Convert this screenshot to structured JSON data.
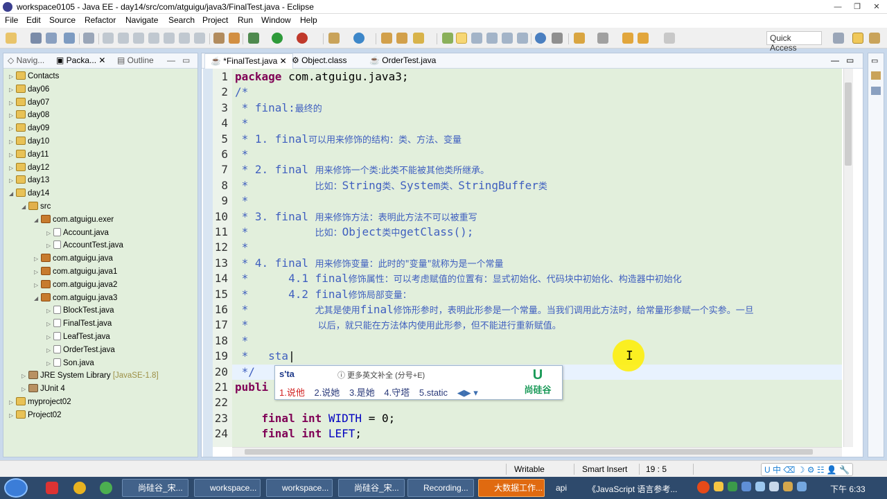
{
  "window": {
    "title": "workspace0105 - Java EE - day14/src/com/atguigu/java3/FinalTest.java - Eclipse",
    "controls": [
      "—",
      "❐",
      "✕"
    ]
  },
  "menu": [
    "File",
    "Edit",
    "Source",
    "Refactor",
    "Navigate",
    "Search",
    "Project",
    "Run",
    "Window",
    "Help"
  ],
  "toolbar": {
    "quick_access": "Quick Access"
  },
  "left_panel": {
    "tabs": [
      "Navig...",
      "Packa...",
      "Outline"
    ],
    "tree": [
      {
        "label": "Contacts",
        "depth": 0,
        "toggle": "▷",
        "type": "proj"
      },
      {
        "label": "day06",
        "depth": 0,
        "toggle": "▷",
        "type": "proj"
      },
      {
        "label": "day07",
        "depth": 0,
        "toggle": "▷",
        "type": "proj"
      },
      {
        "label": "day08",
        "depth": 0,
        "toggle": "▷",
        "type": "proj"
      },
      {
        "label": "day09",
        "depth": 0,
        "toggle": "▷",
        "type": "proj"
      },
      {
        "label": "day10",
        "depth": 0,
        "toggle": "▷",
        "type": "proj"
      },
      {
        "label": "day11",
        "depth": 0,
        "toggle": "▷",
        "type": "proj"
      },
      {
        "label": "day12",
        "depth": 0,
        "toggle": "▷",
        "type": "proj"
      },
      {
        "label": "day13",
        "depth": 0,
        "toggle": "▷",
        "type": "proj"
      },
      {
        "label": "day14",
        "depth": 0,
        "toggle": "◢",
        "type": "proj"
      },
      {
        "label": "src",
        "depth": 1,
        "toggle": "◢",
        "type": "src"
      },
      {
        "label": "com.atguigu.exer",
        "depth": 2,
        "toggle": "◢",
        "type": "pkg"
      },
      {
        "label": "Account.java",
        "depth": 3,
        "toggle": "▷",
        "type": "java"
      },
      {
        "label": "AccountTest.java",
        "depth": 3,
        "toggle": "▷",
        "type": "java"
      },
      {
        "label": "com.atguigu.java",
        "depth": 2,
        "toggle": "▷",
        "type": "pkg"
      },
      {
        "label": "com.atguigu.java1",
        "depth": 2,
        "toggle": "▷",
        "type": "pkg"
      },
      {
        "label": "com.atguigu.java2",
        "depth": 2,
        "toggle": "▷",
        "type": "pkg"
      },
      {
        "label": "com.atguigu.java3",
        "depth": 2,
        "toggle": "◢",
        "type": "pkg"
      },
      {
        "label": "BlockTest.java",
        "depth": 3,
        "toggle": "▷",
        "type": "java"
      },
      {
        "label": "FinalTest.java",
        "depth": 3,
        "toggle": "▷",
        "type": "java"
      },
      {
        "label": "LeafTest.java",
        "depth": 3,
        "toggle": "▷",
        "type": "java"
      },
      {
        "label": "OrderTest.java",
        "depth": 3,
        "toggle": "▷",
        "type": "java"
      },
      {
        "label": "Son.java",
        "depth": 3,
        "toggle": "▷",
        "type": "java"
      },
      {
        "label": "JRE System Library",
        "suffix": "[JavaSE-1.8]",
        "depth": 1,
        "toggle": "▷",
        "type": "lib"
      },
      {
        "label": "JUnit 4",
        "depth": 1,
        "toggle": "▷",
        "type": "lib"
      },
      {
        "label": "myproject02",
        "depth": 0,
        "toggle": "▷",
        "type": "proj"
      },
      {
        "label": "Project02",
        "depth": 0,
        "toggle": "▷",
        "type": "proj"
      }
    ]
  },
  "editor": {
    "tabs": [
      "*FinalTest.java",
      "Object.class",
      "OrderTest.java"
    ],
    "lines": [
      {
        "n": "1",
        "html": "<span class=\"kw\">package</span><span class=\"plain\"> com.atguigu.java3;</span>"
      },
      {
        "n": "2",
        "html": "<span class=\"cm\">/*</span>"
      },
      {
        "n": "3",
        "html": "<span class=\"cm\"> * final:</span><span class=\"cmcn\">最终的</span>"
      },
      {
        "n": "4",
        "html": "<span class=\"cm\"> *</span>"
      },
      {
        "n": "5",
        "html": "<span class=\"cm\"> * 1. final</span><span class=\"cmcn\">可以用来修饰的结构：类、方法、变量</span>"
      },
      {
        "n": "6",
        "html": "<span class=\"cm\"> *</span>"
      },
      {
        "n": "7",
        "html": "<span class=\"cm\"> * 2. final </span><span class=\"cmcn\">用来修饰一个类:此类不能被其他类所继承。</span>"
      },
      {
        "n": "8",
        "html": "<span class=\"cm\"> *          </span><span class=\"cmcn\">比如：</span><span class=\"cm\">String</span><span class=\"cmcn\">类、</span><span class=\"cm\">System</span><span class=\"cmcn\">类、</span><span class=\"cm\">StringBuffer</span><span class=\"cmcn\">类</span>"
      },
      {
        "n": "9",
        "html": "<span class=\"cm\"> *</span>"
      },
      {
        "n": "10",
        "html": "<span class=\"cm\"> * 3. final </span><span class=\"cmcn\">用来修饰方法：表明此方法不可以被重写</span>"
      },
      {
        "n": "11",
        "html": "<span class=\"cm\"> *          </span><span class=\"cmcn\">比如：</span><span class=\"cm\">Object</span><span class=\"cmcn\">类中</span><span class=\"cm\">getClass();</span>"
      },
      {
        "n": "12",
        "html": "<span class=\"cm\"> *</span>"
      },
      {
        "n": "13",
        "html": "<span class=\"cm\"> * 4. final </span><span class=\"cmcn\">用来修饰变量：此时的\"变量\"就称为是一个常量</span>"
      },
      {
        "n": "14",
        "html": "<span class=\"cm\"> *      4.1 final</span><span class=\"cmcn\">修饰属性：可以考虑赋值的位置有：显式初始化、代码块中初始化、构造器中初始化</span>"
      },
      {
        "n": "15",
        "html": "<span class=\"cm\"> *      4.2 final</span><span class=\"cmcn\">修饰局部变量：</span>"
      },
      {
        "n": "16",
        "html": "<span class=\"cm\"> *          </span><span class=\"cmcn\">尤其是使用</span><span class=\"cm\">final</span><span class=\"cmcn\">修饰形参时，表明此形参是一个常量。当我们调用此方法时，给常量形参赋一个实参。一旦</span>"
      },
      {
        "n": "17",
        "html": "<span class=\"cm\"> *          </span><span class=\"cmcn\"> 以后，就只能在方法体内使用此形参，但不能进行重新赋值。</span>"
      },
      {
        "n": "18",
        "html": "<span class=\"cm\"> *</span>"
      },
      {
        "n": "19",
        "html": "<span class=\"cm\"> *   sta</span><span class=\"plain\">|</span>"
      },
      {
        "n": "20",
        "html": "<span class=\"cm\"> */</span>"
      },
      {
        "n": "21",
        "html": "<span class=\"kw\">publi</span>"
      },
      {
        "n": "22",
        "html": ""
      },
      {
        "n": "23",
        "html": "<span class=\"plain\">    </span><span class=\"kw\">final</span><span class=\"plain\"> </span><span class=\"kw\">int</span><span class=\"plain\"> </span><span class=\"fld\">WIDTH</span><span class=\"plain\"> = 0;</span>"
      },
      {
        "n": "24",
        "html": "<span class=\"plain\">    </span><span class=\"kw\">final</span><span class=\"plain\"> </span><span class=\"kw\">int</span><span class=\"plain\"> </span><span class=\"fld\">LEFT</span><span class=\"plain\">;</span>"
      }
    ]
  },
  "ime": {
    "composition": "s'ta",
    "hint": "ⓘ 更多英文补全 (分号+E)",
    "candidates": [
      "1.说他",
      "2.说她",
      "3.是她",
      "4.守塔",
      "5.static"
    ],
    "nav": "◀▶ ▾",
    "logo_text": "尚硅谷",
    "logo_mark": "U"
  },
  "status": {
    "mode": "Writable",
    "insert": "Smart Insert",
    "position": "19 : 5"
  },
  "taskbar": {
    "tasks": [
      "尚硅谷_宋...",
      "workspace...",
      "workspace...",
      "尚硅谷_宋...",
      "Recording...",
      "大数据工作..."
    ],
    "extra_text": "api",
    "browser_tab": "《JavaScript 语言参考...",
    "clock": "下午 6:33",
    "tray": "U 中 ⌫ ☽ ⚙ ☷ 👤 🔧"
  }
}
